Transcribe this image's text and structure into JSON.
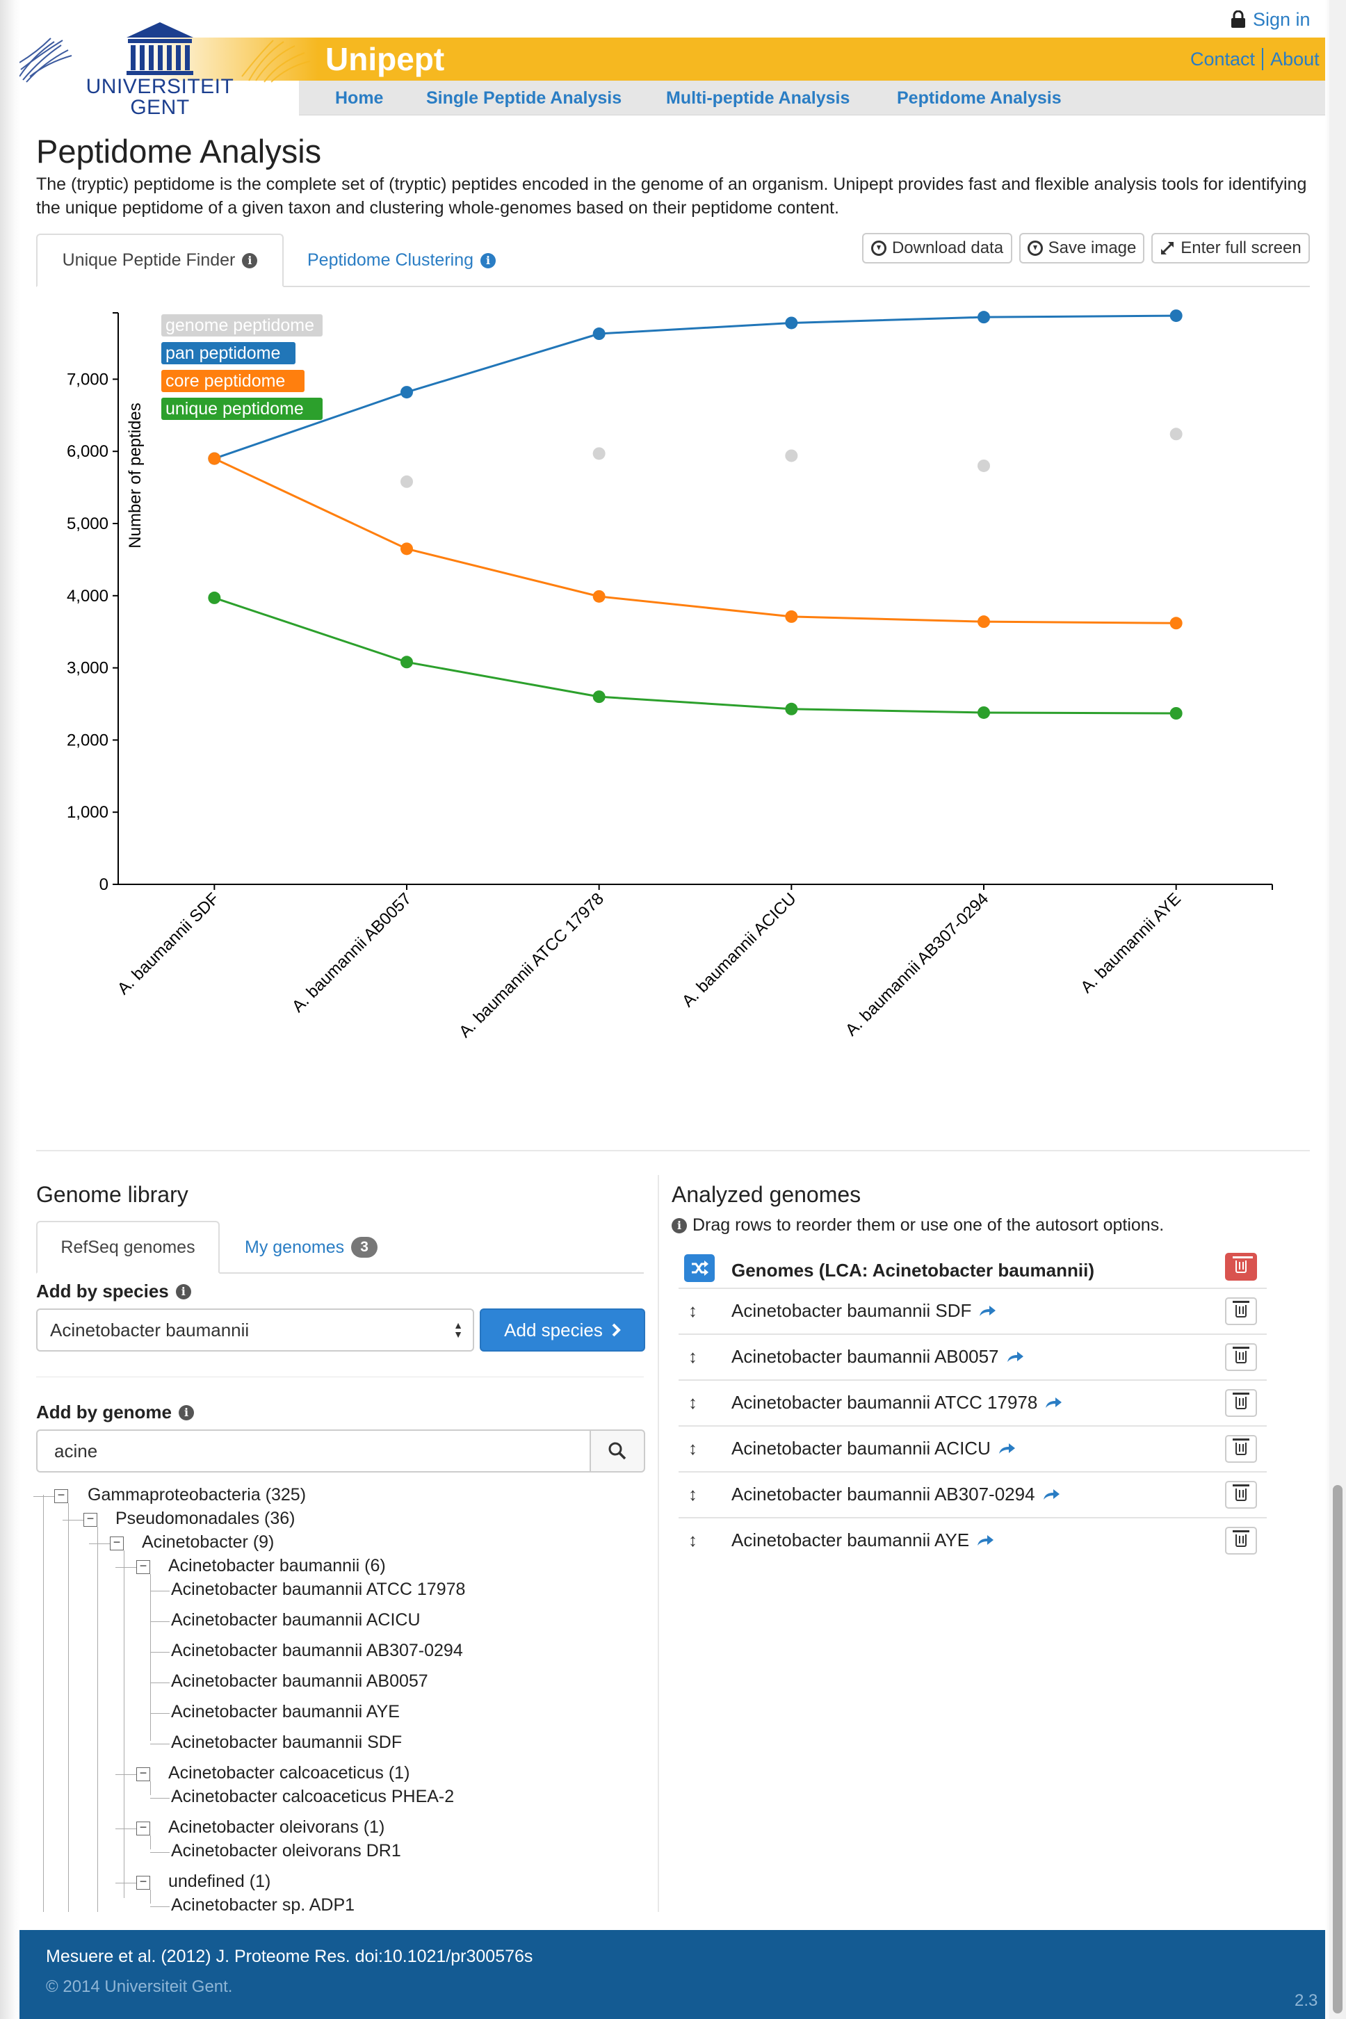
{
  "header": {
    "signin_label": "Sign in",
    "logo_line1": "UNIVERSITEIT",
    "logo_line2": "GENT",
    "app_title": "Unipept",
    "contact_label": "Contact",
    "about_label": "About",
    "nav": [
      "Home",
      "Single Peptide Analysis",
      "Multi-peptide Analysis",
      "Peptidome Analysis"
    ],
    "brand_color": "#f6b820",
    "link_color": "#2a7dc4"
  },
  "main": {
    "title": "Peptidome Analysis",
    "intro": "The (tryptic) peptidome is the complete set of (tryptic) peptides encoded in the genome of an organism. Unipept provides fast and flexible analysis tools for identifying the unique peptidome of a given taxon and clustering whole-genomes based on their peptidome content.",
    "tabs": [
      {
        "label": "Unique Peptide Finder",
        "active": true
      },
      {
        "label": "Peptidome Clustering",
        "active": false
      }
    ],
    "actions": [
      "Download data",
      "Save image",
      "Enter full screen"
    ]
  },
  "chart_data": {
    "type": "line",
    "ylabel": "Number of peptides",
    "ylim": [
      0,
      7900
    ],
    "yticks": [
      "0",
      "1,000",
      "2,000",
      "3,000",
      "4,000",
      "5,000",
      "6,000",
      "7,000"
    ],
    "ytick_values": [
      0,
      1000,
      2000,
      3000,
      4000,
      5000,
      6000,
      7000
    ],
    "categories": [
      "A. baumannii SDF",
      "A. baumannii AB0057",
      "A. baumannii ATCC 17978",
      "A. baumannii ACICU",
      "A. baumannii AB307-0294",
      "A. baumannii AYE"
    ],
    "legend_placement": "top-left",
    "series": [
      {
        "name": "genome peptidome",
        "color": "#d3d3d3",
        "points_only": true,
        "values": [
          5900,
          5580,
          5970,
          5940,
          5800,
          6240
        ]
      },
      {
        "name": "pan peptidome",
        "color": "#2176b8",
        "values": [
          5900,
          6820,
          7630,
          7780,
          7860,
          7880
        ]
      },
      {
        "name": "core peptidome",
        "color": "#ff7f0e",
        "values": [
          5900,
          4650,
          3990,
          3710,
          3640,
          3620
        ]
      },
      {
        "name": "unique peptidome",
        "color": "#2ca02c",
        "values": [
          3970,
          3080,
          2600,
          2430,
          2380,
          2370
        ]
      }
    ]
  },
  "library": {
    "title": "Genome library",
    "tabs": [
      {
        "label": "RefSeq genomes",
        "active": true
      },
      {
        "label": "My genomes",
        "badge": "3"
      }
    ],
    "add_species_label": "Add by species",
    "species_value": "Acinetobacter baumannii",
    "add_species_button": "Add species",
    "add_genome_label": "Add by genome",
    "search_value": "acine",
    "tree": [
      {
        "label": "Gammaproteobacteria (325)",
        "depth": 0,
        "expanded": true
      },
      {
        "label": "Pseudomonadales (36)",
        "depth": 1,
        "expanded": true
      },
      {
        "label": "Acinetobacter (9)",
        "depth": 2,
        "expanded": true
      },
      {
        "label": "Acinetobacter baumannii (6)",
        "depth": 3,
        "expanded": true
      },
      {
        "label": "Acinetobacter baumannii ATCC 17978",
        "depth": 4
      },
      {
        "label": "Acinetobacter baumannii ACICU",
        "depth": 4
      },
      {
        "label": "Acinetobacter baumannii AB307-0294",
        "depth": 4
      },
      {
        "label": "Acinetobacter baumannii AB0057",
        "depth": 4
      },
      {
        "label": "Acinetobacter baumannii AYE",
        "depth": 4
      },
      {
        "label": "Acinetobacter baumannii SDF",
        "depth": 4
      },
      {
        "label": "Acinetobacter calcoaceticus (1)",
        "depth": 3,
        "expanded": true
      },
      {
        "label": "Acinetobacter calcoaceticus PHEA-2",
        "depth": 4
      },
      {
        "label": "Acinetobacter oleivorans (1)",
        "depth": 3,
        "expanded": true
      },
      {
        "label": "Acinetobacter oleivorans DR1",
        "depth": 4
      },
      {
        "label": "undefined (1)",
        "depth": 3,
        "expanded": true
      },
      {
        "label": "Acinetobacter sp. ADP1",
        "depth": 4
      }
    ]
  },
  "analyzed": {
    "title": "Analyzed genomes",
    "hint": "Drag rows to reorder them or use one of the autosort options.",
    "header": "Genomes (LCA: Acinetobacter baumannii)",
    "rows": [
      "Acinetobacter baumannii SDF",
      "Acinetobacter baumannii AB0057",
      "Acinetobacter baumannii ATCC 17978",
      "Acinetobacter baumannii ACICU",
      "Acinetobacter baumannii AB307-0294",
      "Acinetobacter baumannii AYE"
    ]
  },
  "footer": {
    "citation": "Mesuere et al. (2012) J. Proteome Res. doi:10.1021/pr300576s",
    "copyright": "© 2014 Universiteit Gent.",
    "version": "2.3"
  }
}
